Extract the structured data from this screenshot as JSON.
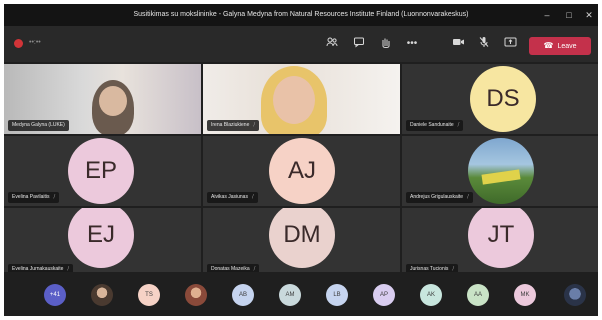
{
  "window": {
    "title": "Susitikimas su mokslininke - Galyna Medyna from Natural Resources Institute Finland (Luonnonvarakeskus)",
    "minimize_glyph": "–",
    "maximize_glyph": "□",
    "close_glyph": "✕"
  },
  "toolbar": {
    "timer": "••:••",
    "leave_label": "Leave",
    "icons": [
      "people-icon",
      "chat-icon",
      "raise-hand-icon",
      "more-icon",
      "camera-icon",
      "mic-icon",
      "share-icon"
    ],
    "more_glyph": "•••"
  },
  "participants": [
    {
      "name": "Medyna Galyna (LUKE)",
      "type": "video"
    },
    {
      "name": "Irena Blaziukiene",
      "type": "video"
    },
    {
      "name": "Daniele Sandunaite",
      "initials": "DS",
      "color": "#f7e6a1"
    },
    {
      "name": "Evelina Pavilaitis",
      "initials": "EP",
      "color": "#ecc9dc"
    },
    {
      "name": "Aivikas Jasiunas",
      "initials": "AJ",
      "color": "#f6d2c6"
    },
    {
      "name": "Andrejus Grigulauskaite",
      "type": "photo"
    },
    {
      "name": "Evelina Jurnakauskaite",
      "initials": "EJ",
      "color": "#ecc9dc"
    },
    {
      "name": "Donatas Mazeika",
      "initials": "DM",
      "color": "#ead2ce"
    },
    {
      "name": "Jurisnas Tucionis",
      "initials": "JT",
      "color": "#ecc9dc"
    }
  ],
  "bottom_strip": [
    {
      "label": "+41",
      "color": "#5b5fc7"
    },
    {
      "label": "",
      "color": "#6b5a4c",
      "photo": true
    },
    {
      "label": "TS",
      "color": "#f6d2c6"
    },
    {
      "label": "",
      "color": "#8a6e5a",
      "photo": true
    },
    {
      "label": "AB",
      "color": "#c6d4ef"
    },
    {
      "label": "AM",
      "color": "#c9d9dc"
    },
    {
      "label": "LB",
      "color": "#c6d4ef"
    },
    {
      "label": "AP",
      "color": "#d9cdf0"
    },
    {
      "label": "AK",
      "color": "#c8e6de"
    },
    {
      "label": "AA",
      "color": "#c9e3c6"
    },
    {
      "label": "MK",
      "color": "#ecc9dc"
    },
    {
      "label": "",
      "color": "#3d4b66",
      "photo": true
    }
  ]
}
